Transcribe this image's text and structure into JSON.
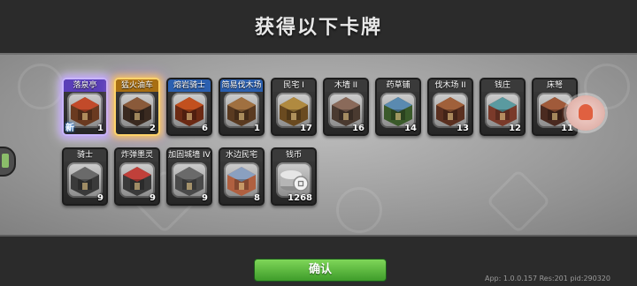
{
  "title": "获得以下卡牌",
  "confirm_label": "确认",
  "version_text": "App: 1.0.0.157 Res:201 pid:290320",
  "new_tag": "新",
  "cards": [
    {
      "name": "落泉亭",
      "count": "1",
      "rarity": "epic",
      "is_new": true,
      "icon": "pavilion-icon"
    },
    {
      "name": "猛火油车",
      "count": "2",
      "rarity": "legend",
      "is_new": false,
      "icon": "fire-cart-icon"
    },
    {
      "name": "熔岩骑士",
      "count": "6",
      "rarity": "rare",
      "is_new": false,
      "icon": "lava-knight-icon"
    },
    {
      "name": "简易伐木场",
      "count": "1",
      "rarity": "rare",
      "is_new": false,
      "icon": "lumber-camp-icon"
    },
    {
      "name": "民宅 I",
      "count": "17",
      "rarity": "normal",
      "is_new": false,
      "icon": "house-icon"
    },
    {
      "name": "木墙 II",
      "count": "16",
      "rarity": "normal",
      "is_new": false,
      "icon": "wood-wall-icon"
    },
    {
      "name": "药草铺",
      "count": "14",
      "rarity": "normal",
      "is_new": false,
      "icon": "herb-shop-icon"
    },
    {
      "name": "伐木场 II",
      "count": "13",
      "rarity": "normal",
      "is_new": false,
      "icon": "sawmill-icon"
    },
    {
      "name": "钱庄",
      "count": "12",
      "rarity": "normal",
      "is_new": false,
      "icon": "bank-icon"
    },
    {
      "name": "床弩",
      "count": "11",
      "rarity": "normal",
      "is_new": false,
      "icon": "ballista-icon"
    },
    {
      "name": "骑士",
      "count": "9",
      "rarity": "normal",
      "is_new": false,
      "icon": "knight-icon"
    },
    {
      "name": "炸弹墨灵",
      "count": "9",
      "rarity": "normal",
      "is_new": false,
      "icon": "bomb-spirit-icon"
    },
    {
      "name": "加固城墙 IV",
      "count": "9",
      "rarity": "normal",
      "is_new": false,
      "icon": "stone-wall-icon"
    },
    {
      "name": "水边民宅",
      "count": "8",
      "rarity": "normal",
      "is_new": false,
      "icon": "waterside-house-icon"
    },
    {
      "name": "钱币",
      "count": "1268",
      "rarity": "normal",
      "is_new": false,
      "icon": "coin-icon"
    }
  ],
  "colors": {
    "epic": "#5a3fb8",
    "legend": "#a86f12",
    "rare": "#2a5fb0",
    "confirm": "#4fae33"
  }
}
